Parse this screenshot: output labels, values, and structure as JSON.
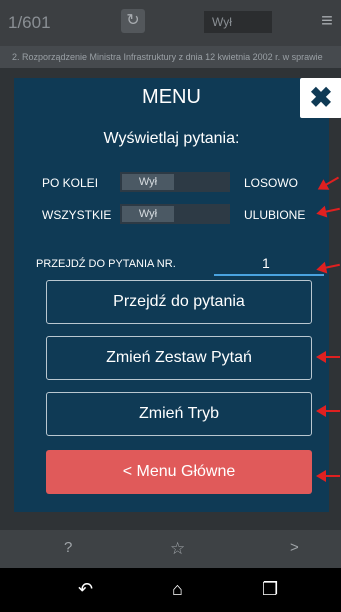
{
  "topbar": {
    "counter": "1/601",
    "toggle_label": "Wył",
    "refresh_icon": "refresh-icon",
    "menu_icon": "hamburger-menu-icon"
  },
  "subtitle": "2. Rozporządzenie Ministra Infrastruktury z dnia 12 kwietnia 2002 r. w sprawie",
  "modal": {
    "title": "MENU",
    "close_icon": "close-icon",
    "section_label": "Wyświetlaj pytania:",
    "row1": {
      "left": "PO KOLEI",
      "toggle": "Wył",
      "right": "LOSOWO"
    },
    "row2": {
      "left": "WSZYSTKIE",
      "toggle": "Wył",
      "right": "ULUBIONE"
    },
    "goto_label": "PRZEJDŹ DO PYTANIA NR.",
    "goto_value": "1",
    "buttons": {
      "goto": "Przejdź do pytania",
      "change_set": "Zmień Zestaw Pytań",
      "change_mode": "Zmień Tryb",
      "main_menu": "< Menu Główne"
    },
    "annotation_color": "#e02020"
  },
  "appbar": {
    "help": "?",
    "star_icon": "star-icon",
    "next": ">"
  },
  "navbar": {
    "back_icon": "back-icon",
    "home_icon": "home-icon",
    "recents_icon": "recents-icon"
  }
}
